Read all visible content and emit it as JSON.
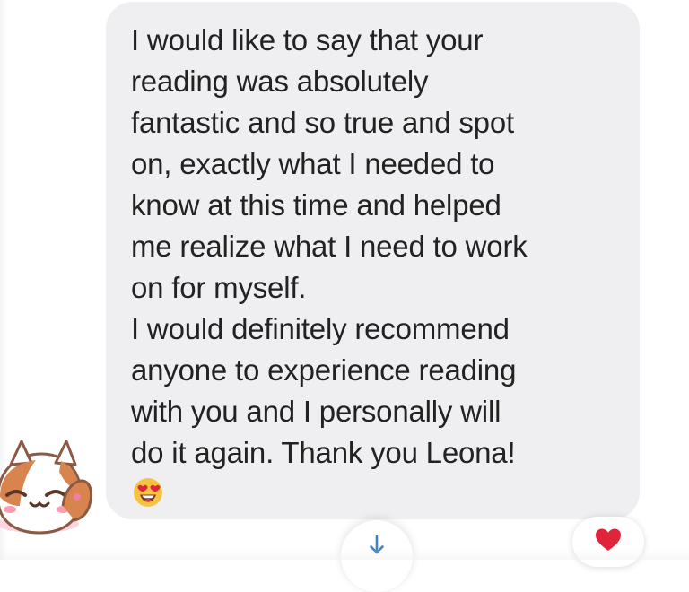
{
  "message": {
    "lines": [
      "I would like to say that your",
      "reading was absolutely",
      "fantastic and so true and spot",
      "on, exactly what I needed to",
      "know at this time and helped",
      "me realize what I need to work",
      "on for myself.",
      "I would definitely recommend",
      "anyone to experience reading",
      "with you and I personally will",
      "do it again. Thank you Leona!"
    ],
    "emoji": "heart-eyes-emoji"
  },
  "sticker": "cat-waving-sticker",
  "controls": {
    "scroll_down_icon": "arrow-down-icon",
    "reaction_icon": "heart-icon"
  },
  "colors": {
    "bubble_background": "#efeff1",
    "text": "#222222",
    "heart": "#e0243a",
    "arrow": "#3b82c4"
  }
}
